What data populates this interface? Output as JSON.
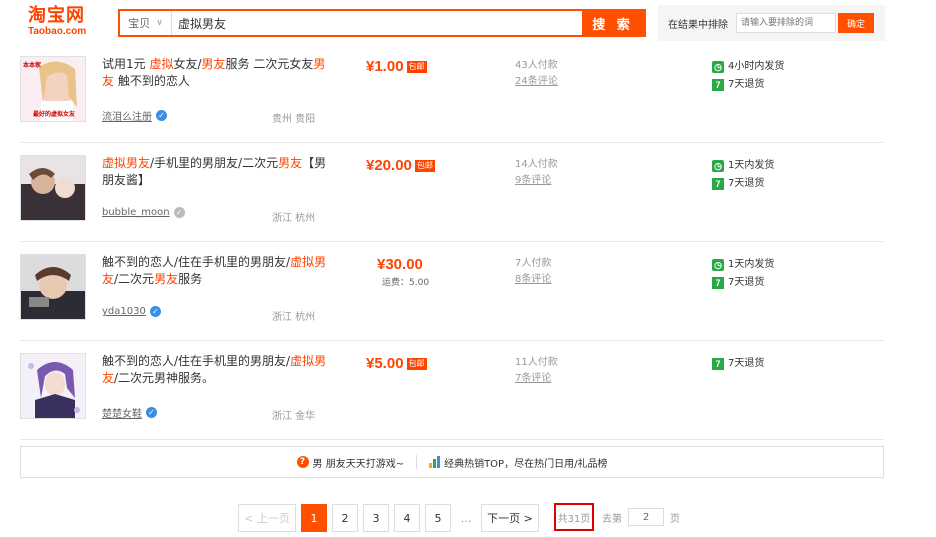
{
  "header": {
    "logo_cn": "淘宝网",
    "logo_en": "Taobao.com",
    "search_scope": "宝贝",
    "search_value": "虚拟男友",
    "search_button": "搜 索",
    "filter_label": "在结果中排除",
    "filter_placeholder": "请输入要排除的词",
    "filter_button": "确定"
  },
  "results": [
    {
      "thumb_text": "最好的虚拟女友",
      "thumb_top": "本本家",
      "title_parts": [
        {
          "t": "试用1元 ",
          "hl": false
        },
        {
          "t": "虚拟",
          "hl": true
        },
        {
          "t": "女友/",
          "hl": false
        },
        {
          "t": "男友",
          "hl": true
        },
        {
          "t": "服务 二次元女友",
          "hl": false
        },
        {
          "t": "男友",
          "hl": true
        },
        {
          "t": " 触不到的恋人",
          "hl": false
        }
      ],
      "seller": "流泪么注册",
      "location": "贵州 贵阳",
      "price": "¥1.00",
      "price_tag": "包邮",
      "fee": "",
      "paid": "43人付款",
      "comments": "24条评论",
      "services": [
        "4小时内发货",
        "7天退货"
      ]
    },
    {
      "thumb_text": "",
      "thumb_top": "",
      "title_parts": [
        {
          "t": "虚拟男友",
          "hl": true
        },
        {
          "t": "/手机里的男朋友/二次元",
          "hl": false
        },
        {
          "t": "男友",
          "hl": true
        },
        {
          "t": "【男朋友酱】",
          "hl": false
        }
      ],
      "seller": "bubble_moon",
      "location": "浙江 杭州",
      "price": "¥20.00",
      "price_tag": "包邮",
      "fee": "",
      "paid": "14人付款",
      "comments": "9条评论",
      "services": [
        "1天内发货",
        "7天退货"
      ]
    },
    {
      "thumb_text": "",
      "thumb_top": "",
      "title_parts": [
        {
          "t": "触不到的恋人/住在手机里的男朋友/",
          "hl": false
        },
        {
          "t": "虚拟男友",
          "hl": true
        },
        {
          "t": "/二次元",
          "hl": false
        },
        {
          "t": "男友",
          "hl": true
        },
        {
          "t": "服务",
          "hl": false
        }
      ],
      "seller": "yda1030",
      "location": "浙江 杭州",
      "price": "¥30.00",
      "price_tag": "",
      "fee": "运费：5.00",
      "paid": "7人付款",
      "comments": "8条评论",
      "services": [
        "1天内发货",
        "7天退货"
      ]
    },
    {
      "thumb_text": "",
      "thumb_top": "",
      "title_parts": [
        {
          "t": "触不到的恋人/住在手机里的男朋友/",
          "hl": false
        },
        {
          "t": "虚拟男友",
          "hl": true
        },
        {
          "t": "/二次元男神服务。",
          "hl": false
        }
      ],
      "seller": "楚楚女鞋",
      "location": "浙江 金华",
      "price": "¥5.00",
      "price_tag": "包邮",
      "fee": "",
      "paid": "11人付款",
      "comments": "7条评论",
      "services": [
        "7天退货"
      ]
    }
  ],
  "recommend": {
    "left": "男 朋友天天打游戏~",
    "right": "经典热销TOP，尽在热门日用/礼品榜"
  },
  "pager": {
    "prev": "< 上一页",
    "pages": [
      "1",
      "2",
      "3",
      "4",
      "5"
    ],
    "dots": "...",
    "next": "下一页 >",
    "total": "共31页",
    "goto_label": "去第",
    "goto_value": "2",
    "goto_suffix": "页"
  },
  "colors": {
    "accent": "#ff5000",
    "price": "#ff4400",
    "service_green": "#2aa845"
  }
}
